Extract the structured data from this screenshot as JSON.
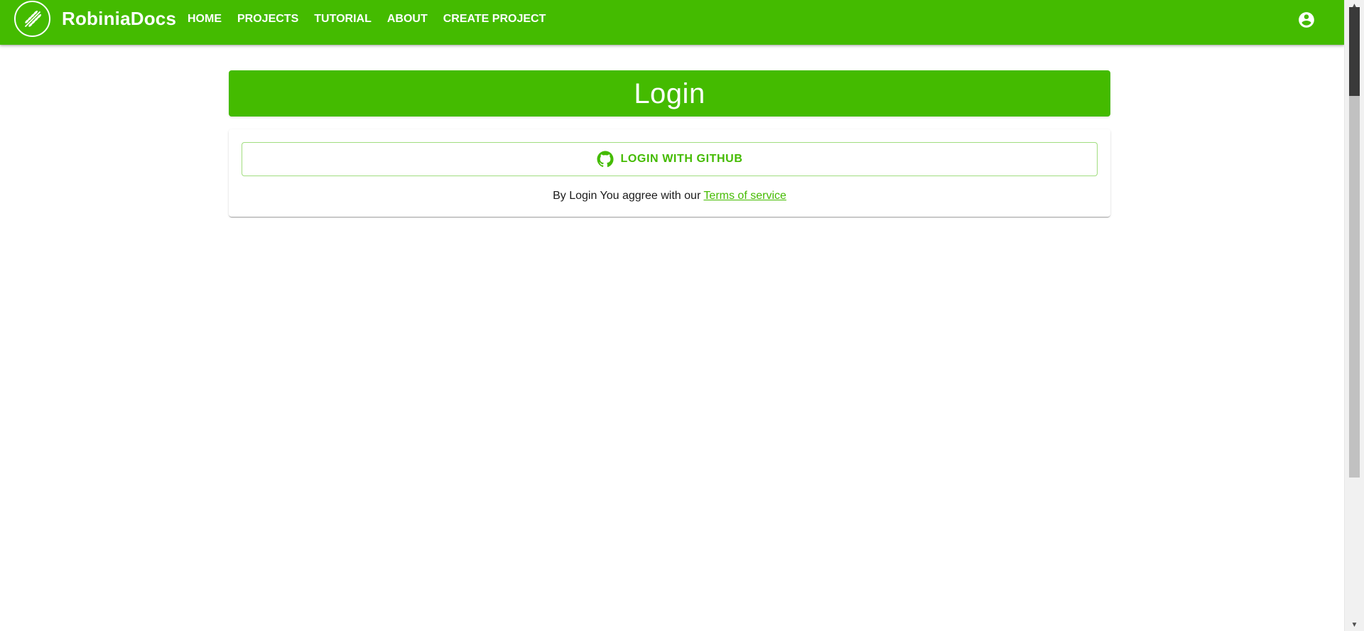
{
  "header": {
    "brand": "RobiniaDocs",
    "nav": [
      {
        "label": "HOME"
      },
      {
        "label": "PROJECTS"
      },
      {
        "label": "TUTORIAL"
      },
      {
        "label": "ABOUT"
      },
      {
        "label": "CREATE PROJECT"
      }
    ],
    "logo_icon": "wheat-leaf-icon",
    "account_icon": "account-circle-icon"
  },
  "main": {
    "title": "Login",
    "github_button": {
      "label": "LOGIN WITH GITHUB",
      "icon": "github-icon"
    },
    "terms": {
      "prefix": "By Login You aggree with our ",
      "link_label": "Terms of service"
    }
  },
  "colors": {
    "brand_green": "#44bb00",
    "text": "#1a1a1a",
    "white": "#ffffff"
  }
}
